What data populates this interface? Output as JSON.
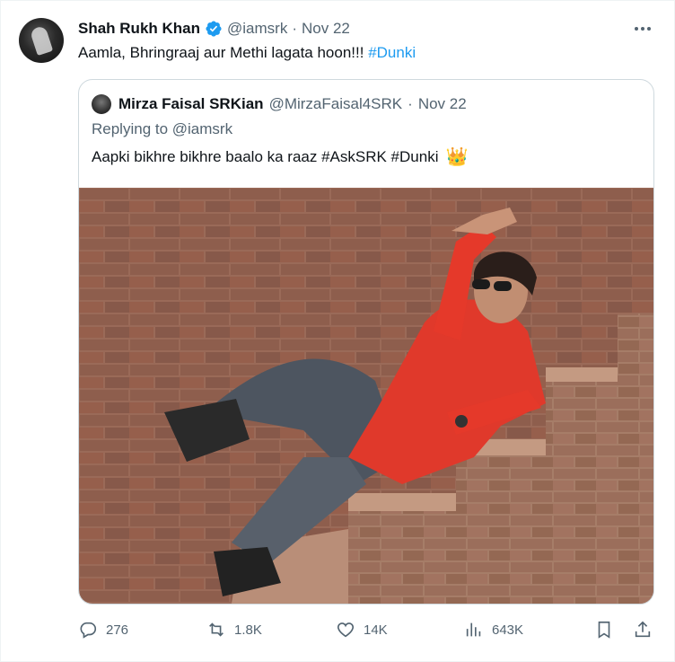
{
  "tweet": {
    "author_name": "Shah Rukh Khan",
    "handle": "@iamsrk",
    "separator": "·",
    "date": "Nov 22",
    "text": "Aamla, Bhringraaj aur Methi  lagata hoon!!! ",
    "hashtag": "#Dunki"
  },
  "quote": {
    "author_name": "Mirza Faisal SRKian",
    "handle": "@MirzaFaisal4SRK",
    "separator": "·",
    "date": "Nov 22",
    "replying_to": "Replying to @iamsrk",
    "text": "Aapki bikhre bikhre baalo ka raaz #AskSRK #Dunki",
    "emoji": "👑"
  },
  "actions": {
    "replies": "276",
    "reposts": "1.8K",
    "likes": "14K",
    "views": "643K"
  },
  "colors": {
    "link": "#1d9bf0",
    "muted": "#536471",
    "verified": "#1d9bf0",
    "shirt": "#e0392b",
    "brick": "#8c5a48"
  },
  "icons": [
    "verified-badge-icon",
    "more-icon",
    "reply-icon",
    "repost-icon",
    "like-icon",
    "views-icon",
    "bookmark-icon",
    "share-icon"
  ]
}
